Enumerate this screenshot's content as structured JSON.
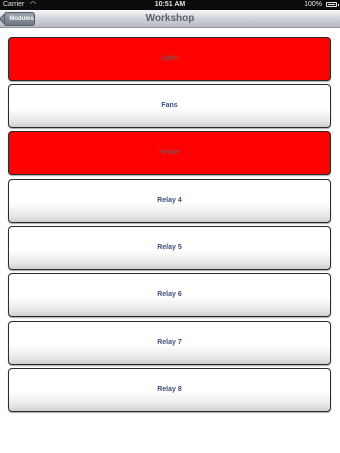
{
  "status_bar": {
    "carrier": "Carrier",
    "wifi_icon": "wifi-icon",
    "time": "10:51 AM",
    "battery_percent": "100%",
    "battery_icon": "battery-icon"
  },
  "nav": {
    "title": "Workshop",
    "back_label": "Modules"
  },
  "colors": {
    "on": "#ff0000",
    "off": "#ffffff",
    "label": "#3c4f7a"
  },
  "relays": [
    {
      "label": "Lights",
      "state": "on"
    },
    {
      "label": "Fans",
      "state": "off"
    },
    {
      "label": "Heater",
      "state": "on"
    },
    {
      "label": "Relay 4",
      "state": "off"
    },
    {
      "label": "Relay 5",
      "state": "off"
    },
    {
      "label": "Relay 6",
      "state": "off"
    },
    {
      "label": "Relay 7",
      "state": "off"
    },
    {
      "label": "Relay 8",
      "state": "off"
    }
  ]
}
